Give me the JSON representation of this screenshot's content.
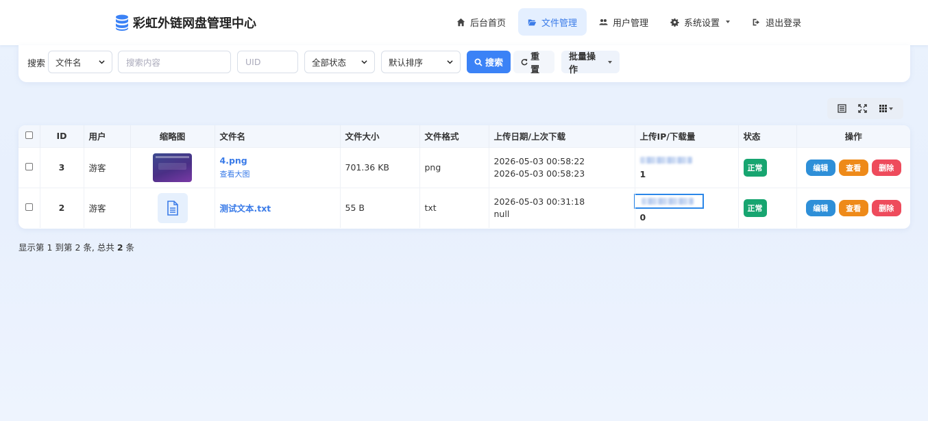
{
  "brand": {
    "title": "彩虹外链网盘管理中心",
    "icon": "database-icon",
    "icon_color": "#3b82f6"
  },
  "nav": {
    "items": [
      {
        "label": "后台首页",
        "icon": "home-icon"
      },
      {
        "label": "文件管理",
        "icon": "folder-open-icon",
        "active": true
      },
      {
        "label": "用户管理",
        "icon": "users-icon"
      },
      {
        "label": "系统设置",
        "icon": "gear-icon",
        "dropdown": true
      },
      {
        "label": "退出登录",
        "icon": "sign-out-icon"
      }
    ]
  },
  "search": {
    "label": "搜索",
    "field_select": "文件名",
    "keyword_placeholder": "搜索内容",
    "uid_placeholder": "UID",
    "status_select": "全部状态",
    "sort_select": "默认排序",
    "search_button": "搜索",
    "reset_button": "重置",
    "batch_button": "批量操作"
  },
  "toolbar": {
    "icons": [
      "list-view-icon",
      "fullscreen-icon",
      "columns-icon"
    ]
  },
  "table": {
    "headers": {
      "id": "ID",
      "user": "用户",
      "thumb": "缩略图",
      "name": "文件名",
      "size": "文件大小",
      "format": "文件格式",
      "dates": "上传日期/上次下载",
      "ip": "上传IP/下载量",
      "status": "状态",
      "ops": "操作"
    },
    "rows": [
      {
        "id": "3",
        "user": "游客",
        "thumb_type": "image",
        "name": "4.png",
        "sub": "查看大图",
        "size": "701.36 KB",
        "format": "png",
        "upload_date": "2026-05-03 00:58:22",
        "last_download": "2026-05-03 00:58:23",
        "downloads": "1",
        "status": "正常"
      },
      {
        "id": "2",
        "user": "游客",
        "thumb_type": "file",
        "name": "测试文本.txt",
        "sub": "",
        "size": "55 B",
        "format": "txt",
        "upload_date": "2026-05-03 00:31:18",
        "last_download": "null",
        "downloads": "0",
        "status": "正常"
      }
    ],
    "actions": {
      "edit": "编辑",
      "view": "查看",
      "delete": "删除"
    }
  },
  "footer": {
    "prefix": "显示第",
    "from": "1",
    "mid1": "到第",
    "to": "2",
    "mid2": "条, 总共",
    "total": "2",
    "suffix": "条"
  },
  "colors": {
    "primary": "#3b82f6",
    "success": "#17a570",
    "warning": "#ee8a19",
    "danger": "#ee4b5c",
    "info": "#2e8fd8"
  }
}
